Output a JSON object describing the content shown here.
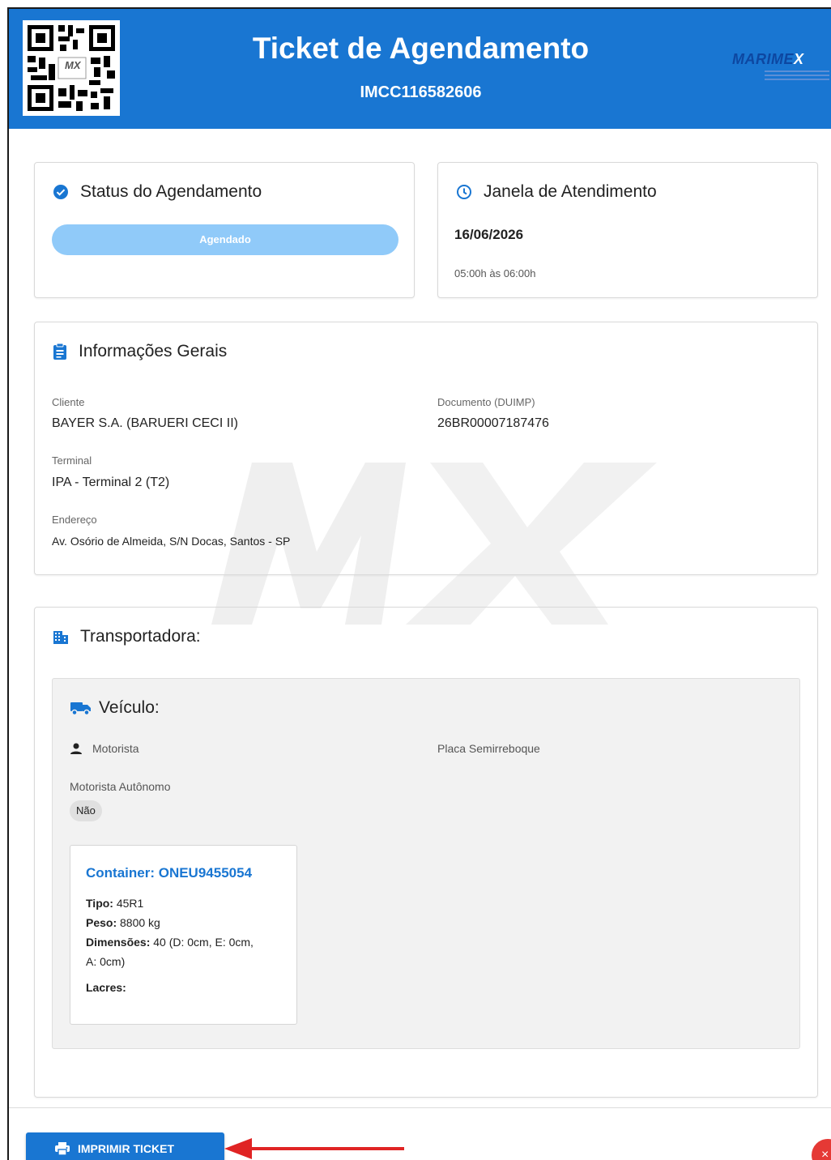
{
  "header": {
    "title": "Ticket de Agendamento",
    "code": "IMCC116582606",
    "logo_text": "MARIME",
    "logo_x": "X",
    "qr_center_text": "MX"
  },
  "status": {
    "title": "Status do Agendamento",
    "value": "Agendado"
  },
  "window": {
    "title": "Janela de Atendimento",
    "date": "16/06/2026",
    "time": "05:00h às 06:00h"
  },
  "info": {
    "title": "Informações Gerais",
    "cliente_label": "Cliente",
    "cliente_value": "BAYER S.A. (BARUERI CECI II)",
    "documento_label": "Documento (DUIMP)",
    "documento_value": "26BR00007187476",
    "terminal_label": "Terminal",
    "terminal_value": "IPA - Terminal 2 (T2)",
    "endereco_label": "Endereço",
    "endereco_value": "Av. Osório de Almeida, S/N Docas, Santos - SP"
  },
  "transportadora": {
    "title": "Transportadora:",
    "vehicle_title": "Veículo:",
    "motorista_label": "Motorista",
    "placa_label": "Placa Semirreboque",
    "autonomo_label": "Motorista Autônomo",
    "autonomo_value": "Não",
    "container": {
      "title": "Container: ONEU9455054",
      "tipo_label": "Tipo:",
      "tipo_value": "45R1",
      "peso_label": "Peso:",
      "peso_value": "8800 kg",
      "dim_label": "Dimensões:",
      "dim_value_1": "40 (D: 0cm, E: 0cm,",
      "dim_value_2": "A: 0cm)",
      "lacres_label": "Lacres:"
    }
  },
  "actions": {
    "print_label": "IMPRIMIR TICKET",
    "close_label": "×"
  },
  "colors": {
    "primary": "#1976d2",
    "status_bar": "#90caf9",
    "annotation_arrow": "#e02424",
    "close": "#e53935"
  }
}
